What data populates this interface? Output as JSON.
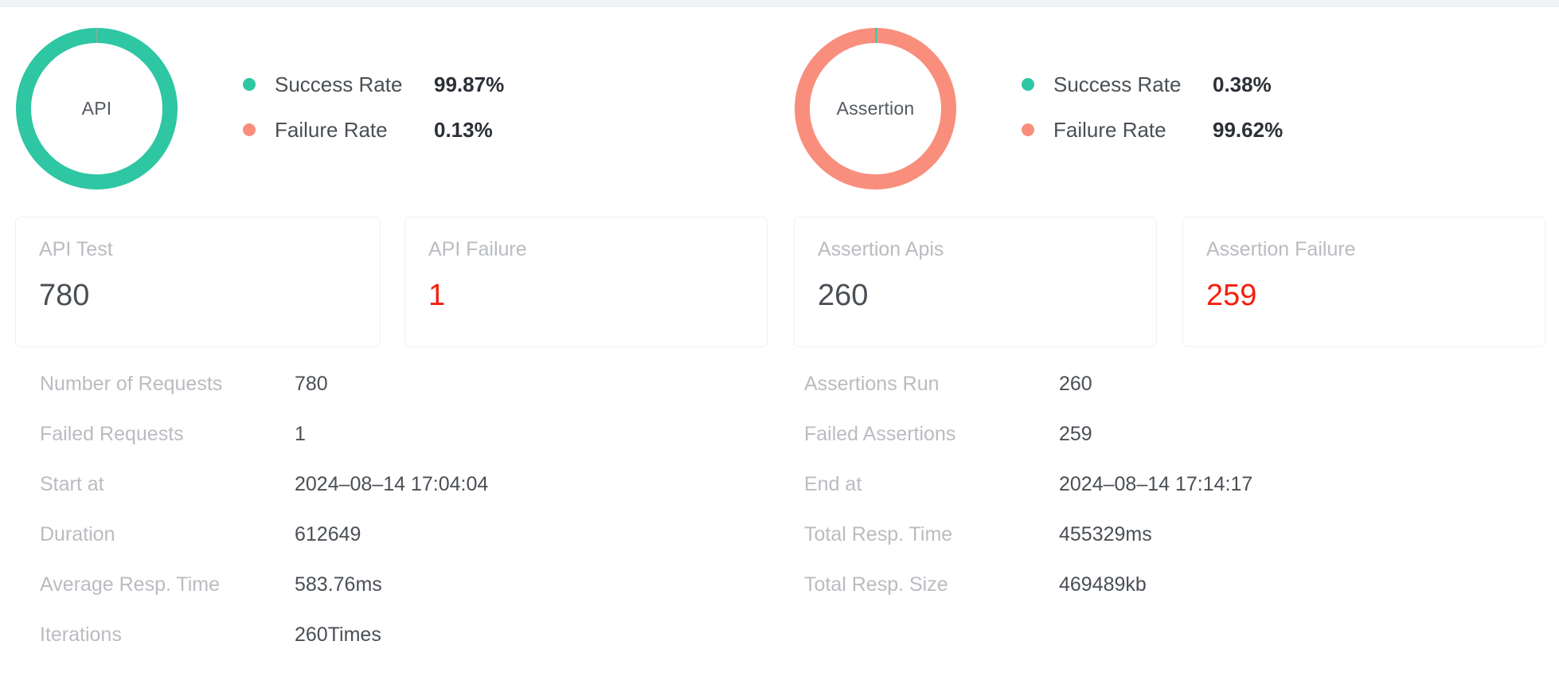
{
  "summary": {
    "charts": [
      {
        "id": "api",
        "center_label": "API",
        "success_color": "#2ec6a3",
        "failure_color": "#f98e7d",
        "legend": [
          {
            "dot": "success",
            "label": "Success Rate",
            "value": "99.87%"
          },
          {
            "dot": "failure",
            "label": "Failure Rate",
            "value": "0.13%"
          }
        ]
      },
      {
        "id": "assertion",
        "center_label": "Assertion",
        "success_color": "#2ec6a3",
        "failure_color": "#f98e7d",
        "legend": [
          {
            "dot": "success",
            "label": "Success Rate",
            "value": "0.38%"
          },
          {
            "dot": "failure",
            "label": "Failure Rate",
            "value": "99.62%"
          }
        ]
      }
    ]
  },
  "cards": [
    {
      "title": "API Test",
      "value": "780",
      "danger": false
    },
    {
      "title": "API Failure",
      "value": "1",
      "danger": true
    },
    {
      "title": "Assertion Apis",
      "value": "260",
      "danger": false
    },
    {
      "title": "Assertion Failure",
      "value": "259",
      "danger": true
    }
  ],
  "details": {
    "left": [
      {
        "label": "Number of Requests",
        "value": "780"
      },
      {
        "label": "Failed Requests",
        "value": "1"
      },
      {
        "label": "Start at",
        "value": "2024–08–14 17:04:04"
      },
      {
        "label": "Duration",
        "value": "612649"
      },
      {
        "label": "Average Resp. Time",
        "value": "583.76ms"
      },
      {
        "label": "Iterations",
        "value": "260Times"
      }
    ],
    "right": [
      {
        "label": "Assertions Run",
        "value": "260"
      },
      {
        "label": "Failed Assertions",
        "value": "259"
      },
      {
        "label": "End at",
        "value": "2024–08–14 17:14:17"
      },
      {
        "label": "Total Resp. Time",
        "value": "455329ms"
      },
      {
        "label": "Total Resp. Size",
        "value": "469489kb"
      }
    ]
  },
  "chart_data": [
    {
      "type": "pie",
      "title": "API",
      "categories": [
        "Success Rate",
        "Failure Rate"
      ],
      "values": [
        99.87,
        0.13
      ],
      "unit": "%",
      "colors": [
        "#2ec6a3",
        "#f98e7d"
      ],
      "legend_position": "right",
      "donut": true,
      "inner_radius_ratio": 0.88
    },
    {
      "type": "pie",
      "title": "Assertion",
      "categories": [
        "Success Rate",
        "Failure Rate"
      ],
      "values": [
        0.38,
        99.62
      ],
      "unit": "%",
      "colors": [
        "#2ec6a3",
        "#f98e7d"
      ],
      "legend_position": "right",
      "donut": true,
      "inner_radius_ratio": 0.88
    }
  ]
}
